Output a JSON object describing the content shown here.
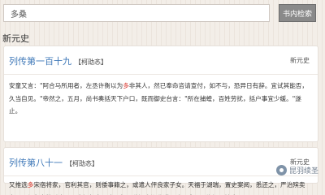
{
  "search": {
    "value": "多桑",
    "button_label": "书内检索"
  },
  "section": {
    "title": "新元史"
  },
  "results": [
    {
      "title": "列传第一百十九",
      "author_open": "【",
      "author": "柯劭忞",
      "author_close": "】",
      "book": "新元史",
      "text_before": "安童又言：\"阿合马所用者，左丞许衡以为",
      "highlight": "多",
      "text_after": "非其人，然已奉命咨请宣付，如不与，恐异日有辞。宜试其能否，久当自见。\"帝然之，五月，尚书奏括天下户口，既而御史台言：\"所在捕蝗，百姓劳扰，括户事宜少缓。\"遂止。"
    },
    {
      "title": "列传第八十一",
      "author_open": "【",
      "author": "柯劭忞",
      "author_close": "】",
      "book": "新元史",
      "text_before": "又推选",
      "highlight": "多",
      "text_after": "宋宿将家，官利其官，则倭事籍之，或遣人伻良家子女。天福于湖瑞，置史案阅，悉还之，严治殡卖之罪，得免者数千人，民立祠祀之。十八年，移江南湖北道。劝平章阿里海涯不法事，不服。"
    }
  ],
  "watermark": {
    "text": "昆羽续圣",
    "icon": "camera-icon"
  }
}
